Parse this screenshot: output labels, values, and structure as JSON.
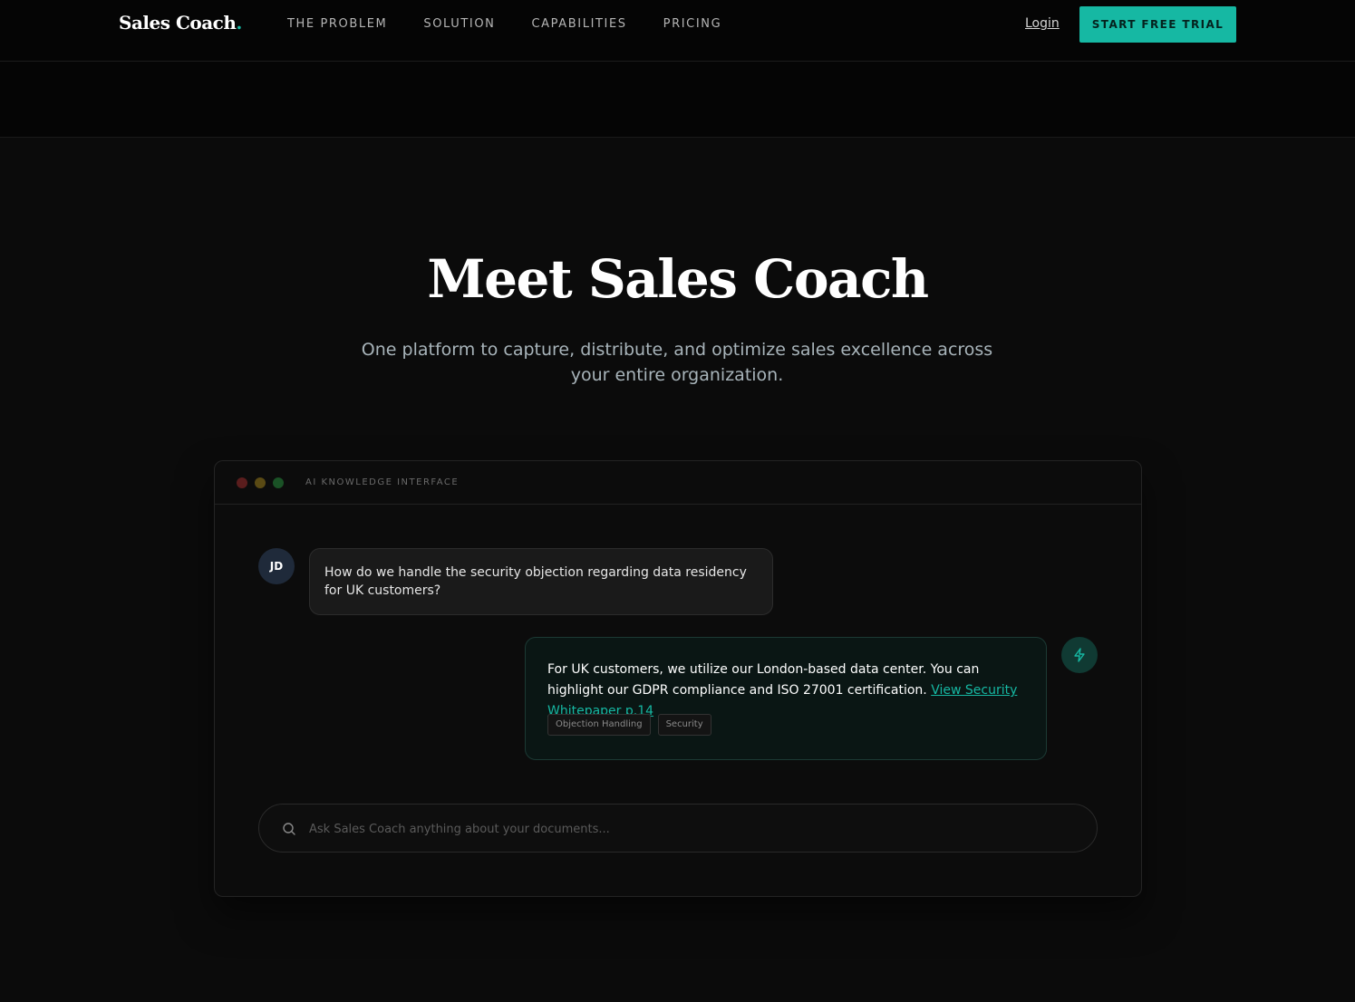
{
  "brand": {
    "name": "Sales Coach",
    "dot": ".",
    "accent": "#16b8a3"
  },
  "nav": {
    "links": [
      "THE PROBLEM",
      "SOLUTION",
      "CAPABILITIES",
      "PRICING"
    ],
    "login": "Login",
    "cta": "START FREE TRIAL"
  },
  "hero": {
    "title": "Meet Sales Coach",
    "subtitle": "One platform to capture, distribute, and optimize sales excellence across your entire organization."
  },
  "chat_window": {
    "title": "AI KNOWLEDGE INTERFACE",
    "user": {
      "initials": "JD",
      "message": "How do we handle the security objection regarding data residency for UK customers?"
    },
    "bot": {
      "icon": "bolt-icon",
      "message": "For UK customers, we utilize our London-based data center. You can highlight our GDPR compliance and ISO 27001 certification. ",
      "link": "View Security Whitepaper p.14",
      "tags": [
        "Objection Handling",
        "Security"
      ]
    },
    "search": {
      "placeholder": "Ask Sales Coach anything about your documents..."
    }
  }
}
